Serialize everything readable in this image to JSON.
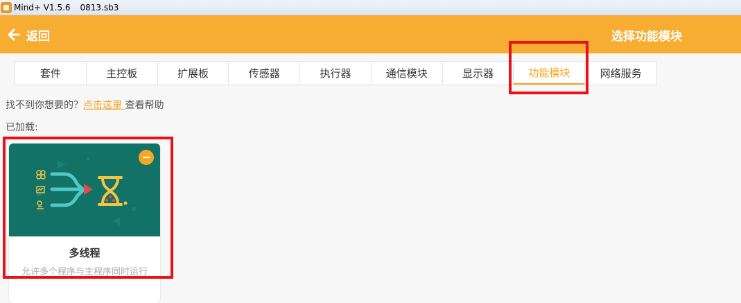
{
  "titlebar": {
    "app": "Mind+ V1.5.6",
    "file": "0813.sb3"
  },
  "header": {
    "back_label": "返回",
    "title": "选择功能模块"
  },
  "tabs": [
    {
      "label": "套件"
    },
    {
      "label": "主控板"
    },
    {
      "label": "扩展板"
    },
    {
      "label": "传感器"
    },
    {
      "label": "执行器"
    },
    {
      "label": "通信模块"
    },
    {
      "label": "显示器"
    },
    {
      "label": "功能模块"
    },
    {
      "label": "网络服务"
    }
  ],
  "active_tab": "功能模块",
  "help": {
    "prefix": "找不到你想要的？",
    "link": "点击这里 ",
    "suffix": "查看帮助"
  },
  "loaded_label": "已加载:",
  "cards": [
    {
      "name": "多线程",
      "description": "允许多个程序与主程序同时运行",
      "icon": "hourglass-threads-icon",
      "action_icon": "minus-circle-icon"
    }
  ],
  "colors": {
    "accent": "#f7ad32",
    "card_image_bg": "#137266",
    "highlight": "#e8111a"
  }
}
